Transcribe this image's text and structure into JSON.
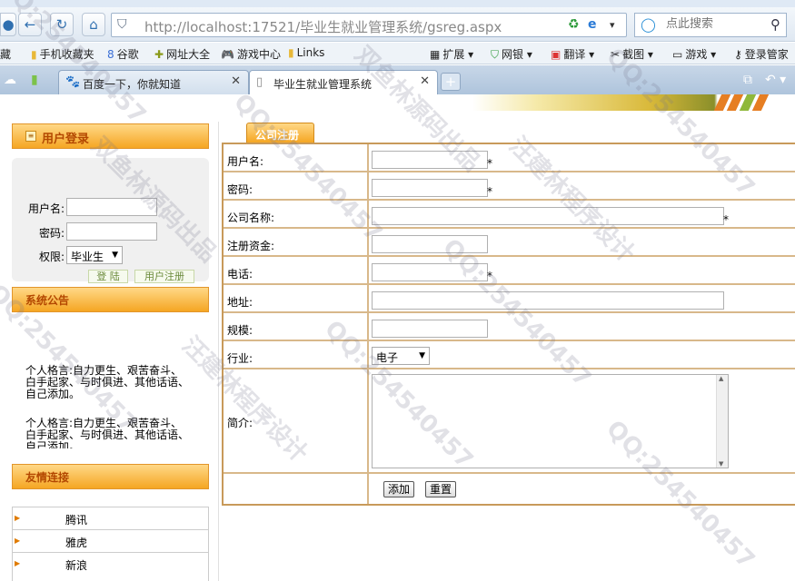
{
  "browser": {
    "window_title": "毕业生就业管理系统",
    "url_host": "http://localhost",
    "url_rest": ":17521/毕业生就业管理系统/gsreg.aspx",
    "search_placeholder": "点此搜索",
    "bookmarks": [
      "藏",
      "手机收藏夹",
      "谷歌",
      "网址大全",
      "游戏中心",
      "Links",
      "扩展",
      "网银",
      "翻译",
      "截图",
      "游戏",
      "登录管家"
    ],
    "tabs": [
      {
        "label": "百度一下，你就知道",
        "active": false
      },
      {
        "label": "毕业生就业管理系统",
        "active": true
      }
    ]
  },
  "sidebar": {
    "login_title": "用户登录",
    "username_label": "用户名:",
    "password_label": "密码:",
    "role_label": "权限:",
    "role_value": "毕业生",
    "login_button": "登 陆",
    "register_button": "用户注册",
    "notice_title": "系统公告",
    "notice_1": "个人格言:自力更生、艰苦奋斗、白手起家、与时俱进、其他话语、自己添加。",
    "notice_2": "个人格言:自力更生、艰苦奋斗、白手起家、与时俱进、其他话语、自己添加。",
    "links_title": "友情连接",
    "links": [
      "腾讯",
      "雅虎",
      "新浪"
    ]
  },
  "form": {
    "tab_title": "公司注册",
    "fields": {
      "username": "用户名:",
      "password": "密码:",
      "company": "公司名称:",
      "capital": "注册资金:",
      "phone": "电话:",
      "address": "地址:",
      "scale": "规模:",
      "industry": "行业:",
      "intro": "简介:"
    },
    "required_mark": "*",
    "industry_value": "电子",
    "add_button": "添加",
    "reset_button": "重置"
  },
  "watermarks": [
    "双鱼林源码出品",
    "QQ:254540457",
    "汪建林程序设计"
  ],
  "colors": {
    "panel_orange": "#f5a623",
    "panel_title": "#b34700",
    "form_border": "#c89a5a"
  }
}
